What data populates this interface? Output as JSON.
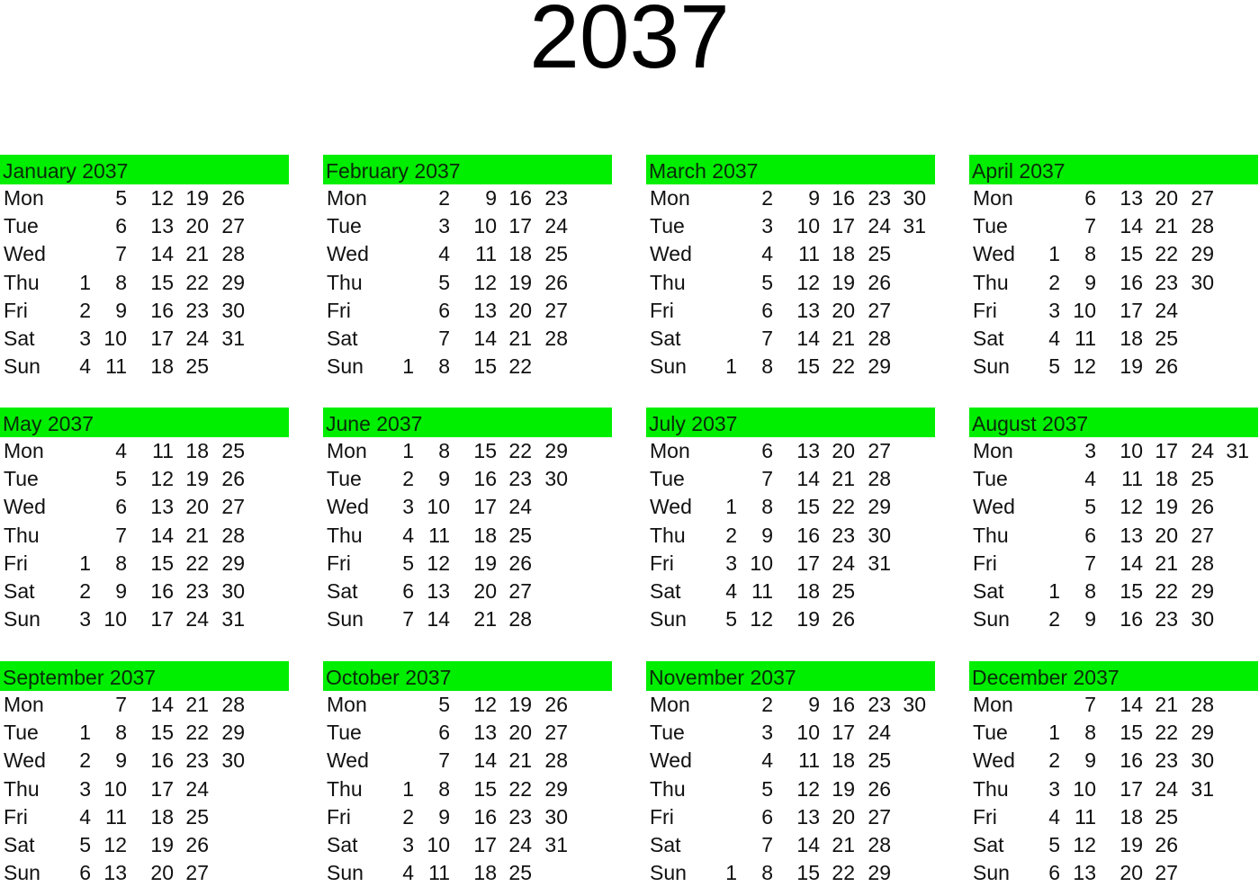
{
  "title": "2037",
  "day_labels": [
    "Mon",
    "Tue",
    "Wed",
    "Thu",
    "Fri",
    "Sat",
    "Sun"
  ],
  "header_color": "#00ee00",
  "months": [
    {
      "name": "January 2037",
      "weeks": [
        [
          "",
          "5",
          "12",
          "19",
          "26",
          ""
        ],
        [
          "",
          "6",
          "13",
          "20",
          "27",
          ""
        ],
        [
          "",
          "7",
          "14",
          "21",
          "28",
          ""
        ],
        [
          "1",
          "8",
          "15",
          "22",
          "29",
          ""
        ],
        [
          "2",
          "9",
          "16",
          "23",
          "30",
          ""
        ],
        [
          "3",
          "10",
          "17",
          "24",
          "31",
          ""
        ],
        [
          "4",
          "11",
          "18",
          "25",
          "",
          ""
        ]
      ]
    },
    {
      "name": "February 2037",
      "weeks": [
        [
          "",
          "2",
          "9",
          "16",
          "23",
          ""
        ],
        [
          "",
          "3",
          "10",
          "17",
          "24",
          ""
        ],
        [
          "",
          "4",
          "11",
          "18",
          "25",
          ""
        ],
        [
          "",
          "5",
          "12",
          "19",
          "26",
          ""
        ],
        [
          "",
          "6",
          "13",
          "20",
          "27",
          ""
        ],
        [
          "",
          "7",
          "14",
          "21",
          "28",
          ""
        ],
        [
          "1",
          "8",
          "15",
          "22",
          "",
          ""
        ]
      ]
    },
    {
      "name": "March 2037",
      "weeks": [
        [
          "",
          "2",
          "9",
          "16",
          "23",
          "30"
        ],
        [
          "",
          "3",
          "10",
          "17",
          "24",
          "31"
        ],
        [
          "",
          "4",
          "11",
          "18",
          "25",
          ""
        ],
        [
          "",
          "5",
          "12",
          "19",
          "26",
          ""
        ],
        [
          "",
          "6",
          "13",
          "20",
          "27",
          ""
        ],
        [
          "",
          "7",
          "14",
          "21",
          "28",
          ""
        ],
        [
          "1",
          "8",
          "15",
          "22",
          "29",
          ""
        ]
      ]
    },
    {
      "name": "April 2037",
      "weeks": [
        [
          "",
          "6",
          "13",
          "20",
          "27",
          ""
        ],
        [
          "",
          "7",
          "14",
          "21",
          "28",
          ""
        ],
        [
          "1",
          "8",
          "15",
          "22",
          "29",
          ""
        ],
        [
          "2",
          "9",
          "16",
          "23",
          "30",
          ""
        ],
        [
          "3",
          "10",
          "17",
          "24",
          "",
          ""
        ],
        [
          "4",
          "11",
          "18",
          "25",
          "",
          ""
        ],
        [
          "5",
          "12",
          "19",
          "26",
          "",
          ""
        ]
      ]
    },
    {
      "name": "May 2037",
      "weeks": [
        [
          "",
          "4",
          "11",
          "18",
          "25",
          ""
        ],
        [
          "",
          "5",
          "12",
          "19",
          "26",
          ""
        ],
        [
          "",
          "6",
          "13",
          "20",
          "27",
          ""
        ],
        [
          "",
          "7",
          "14",
          "21",
          "28",
          ""
        ],
        [
          "1",
          "8",
          "15",
          "22",
          "29",
          ""
        ],
        [
          "2",
          "9",
          "16",
          "23",
          "30",
          ""
        ],
        [
          "3",
          "10",
          "17",
          "24",
          "31",
          ""
        ]
      ]
    },
    {
      "name": "June 2037",
      "weeks": [
        [
          "1",
          "8",
          "15",
          "22",
          "29",
          ""
        ],
        [
          "2",
          "9",
          "16",
          "23",
          "30",
          ""
        ],
        [
          "3",
          "10",
          "17",
          "24",
          "",
          ""
        ],
        [
          "4",
          "11",
          "18",
          "25",
          "",
          ""
        ],
        [
          "5",
          "12",
          "19",
          "26",
          "",
          ""
        ],
        [
          "6",
          "13",
          "20",
          "27",
          "",
          ""
        ],
        [
          "7",
          "14",
          "21",
          "28",
          "",
          ""
        ]
      ]
    },
    {
      "name": "July 2037",
      "weeks": [
        [
          "",
          "6",
          "13",
          "20",
          "27",
          ""
        ],
        [
          "",
          "7",
          "14",
          "21",
          "28",
          ""
        ],
        [
          "1",
          "8",
          "15",
          "22",
          "29",
          ""
        ],
        [
          "2",
          "9",
          "16",
          "23",
          "30",
          ""
        ],
        [
          "3",
          "10",
          "17",
          "24",
          "31",
          ""
        ],
        [
          "4",
          "11",
          "18",
          "25",
          "",
          ""
        ],
        [
          "5",
          "12",
          "19",
          "26",
          "",
          ""
        ]
      ]
    },
    {
      "name": "August 2037",
      "weeks": [
        [
          "",
          "3",
          "10",
          "17",
          "24",
          "31"
        ],
        [
          "",
          "4",
          "11",
          "18",
          "25",
          ""
        ],
        [
          "",
          "5",
          "12",
          "19",
          "26",
          ""
        ],
        [
          "",
          "6",
          "13",
          "20",
          "27",
          ""
        ],
        [
          "",
          "7",
          "14",
          "21",
          "28",
          ""
        ],
        [
          "1",
          "8",
          "15",
          "22",
          "29",
          ""
        ],
        [
          "2",
          "9",
          "16",
          "23",
          "30",
          ""
        ]
      ]
    },
    {
      "name": "September 2037",
      "weeks": [
        [
          "",
          "7",
          "14",
          "21",
          "28",
          ""
        ],
        [
          "1",
          "8",
          "15",
          "22",
          "29",
          ""
        ],
        [
          "2",
          "9",
          "16",
          "23",
          "30",
          ""
        ],
        [
          "3",
          "10",
          "17",
          "24",
          "",
          ""
        ],
        [
          "4",
          "11",
          "18",
          "25",
          "",
          ""
        ],
        [
          "5",
          "12",
          "19",
          "26",
          "",
          ""
        ],
        [
          "6",
          "13",
          "20",
          "27",
          "",
          ""
        ]
      ]
    },
    {
      "name": "October 2037",
      "weeks": [
        [
          "",
          "5",
          "12",
          "19",
          "26",
          ""
        ],
        [
          "",
          "6",
          "13",
          "20",
          "27",
          ""
        ],
        [
          "",
          "7",
          "14",
          "21",
          "28",
          ""
        ],
        [
          "1",
          "8",
          "15",
          "22",
          "29",
          ""
        ],
        [
          "2",
          "9",
          "16",
          "23",
          "30",
          ""
        ],
        [
          "3",
          "10",
          "17",
          "24",
          "31",
          ""
        ],
        [
          "4",
          "11",
          "18",
          "25",
          "",
          ""
        ]
      ]
    },
    {
      "name": "November 2037",
      "weeks": [
        [
          "",
          "2",
          "9",
          "16",
          "23",
          "30"
        ],
        [
          "",
          "3",
          "10",
          "17",
          "24",
          ""
        ],
        [
          "",
          "4",
          "11",
          "18",
          "25",
          ""
        ],
        [
          "",
          "5",
          "12",
          "19",
          "26",
          ""
        ],
        [
          "",
          "6",
          "13",
          "20",
          "27",
          ""
        ],
        [
          "",
          "7",
          "14",
          "21",
          "28",
          ""
        ],
        [
          "1",
          "8",
          "15",
          "22",
          "29",
          ""
        ]
      ]
    },
    {
      "name": "December 2037",
      "weeks": [
        [
          "",
          "7",
          "14",
          "21",
          "28",
          ""
        ],
        [
          "1",
          "8",
          "15",
          "22",
          "29",
          ""
        ],
        [
          "2",
          "9",
          "16",
          "23",
          "30",
          ""
        ],
        [
          "3",
          "10",
          "17",
          "24",
          "31",
          ""
        ],
        [
          "4",
          "11",
          "18",
          "25",
          "",
          ""
        ],
        [
          "5",
          "12",
          "19",
          "26",
          "",
          ""
        ],
        [
          "6",
          "13",
          "20",
          "27",
          "",
          ""
        ]
      ]
    }
  ]
}
